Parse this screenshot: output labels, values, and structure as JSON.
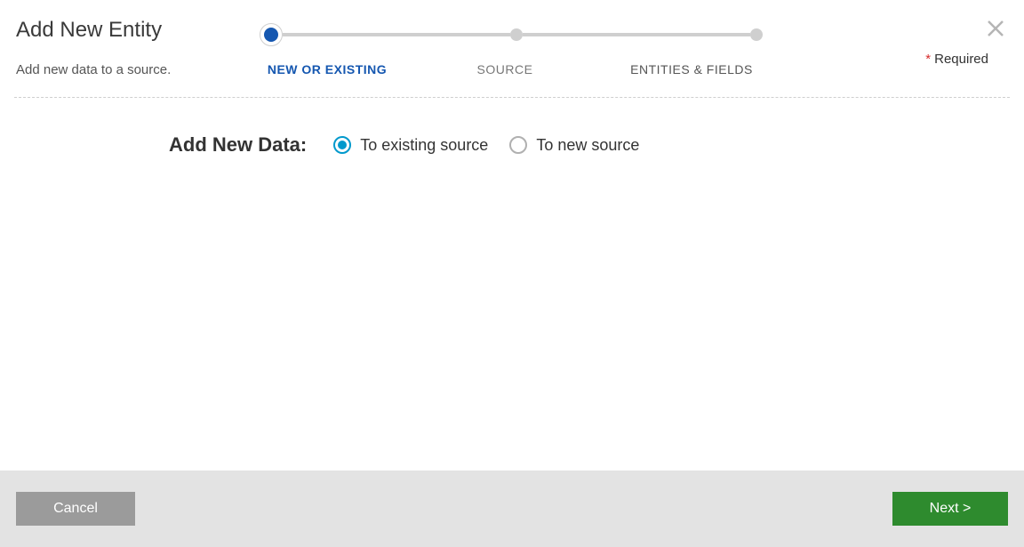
{
  "header": {
    "title": "Add New Entity",
    "subtitle": "Add new data to a source.",
    "required_label": "Required"
  },
  "stepper": {
    "steps": [
      {
        "label": "NEW OR EXISTING",
        "active": true
      },
      {
        "label": "SOURCE",
        "active": false
      },
      {
        "label": "ENTITIES & FIELDS",
        "active": false
      }
    ]
  },
  "form": {
    "prompt": "Add New Data:",
    "options": [
      {
        "label": "To existing source",
        "selected": true
      },
      {
        "label": "To new source",
        "selected": false
      }
    ]
  },
  "footer": {
    "cancel_label": "Cancel",
    "next_label": "Next >"
  }
}
